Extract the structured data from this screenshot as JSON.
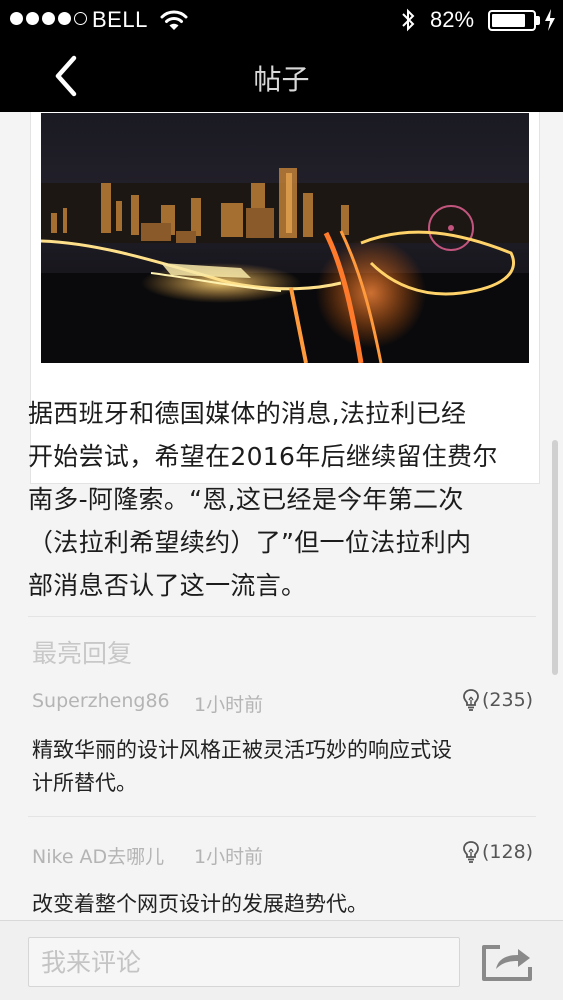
{
  "status_bar": {
    "carrier": "BELL",
    "battery_percent": "82%",
    "battery_level": 0.82
  },
  "nav": {
    "title": "帖子"
  },
  "post": {
    "lines": [
      "据西班牙和德国媒体的消息,法拉利已经",
      "开始尝试，希望在2016年后继续留住费尔",
      "南多-阿隆索。“恩,这已经是今年第二次",
      "（法拉利希望续约）了”但一位法拉利内",
      "部消息否认了这一流言。"
    ]
  },
  "replies_section": {
    "title": "最亮回复",
    "items": [
      {
        "user": "Superzheng86",
        "time": "1小时前",
        "likes": "(235)",
        "text_lines": [
          "精致华丽的设计风格正被灵活巧妙的响应式设",
          "计所替代。"
        ]
      },
      {
        "user": "Nike AD去哪儿",
        "time": "1小时前",
        "likes": "(128)",
        "text_lines": [
          "改变着整个网页设计的发展趋势代。"
        ]
      }
    ]
  },
  "comment_bar": {
    "placeholder": "我来评论"
  },
  "icons": {
    "back": "chevron-left-icon",
    "like": "lightbulb-icon",
    "share": "share-icon",
    "wifi": "wifi-icon",
    "bluetooth": "bluetooth-icon",
    "charging": "charging-bolt-icon"
  }
}
